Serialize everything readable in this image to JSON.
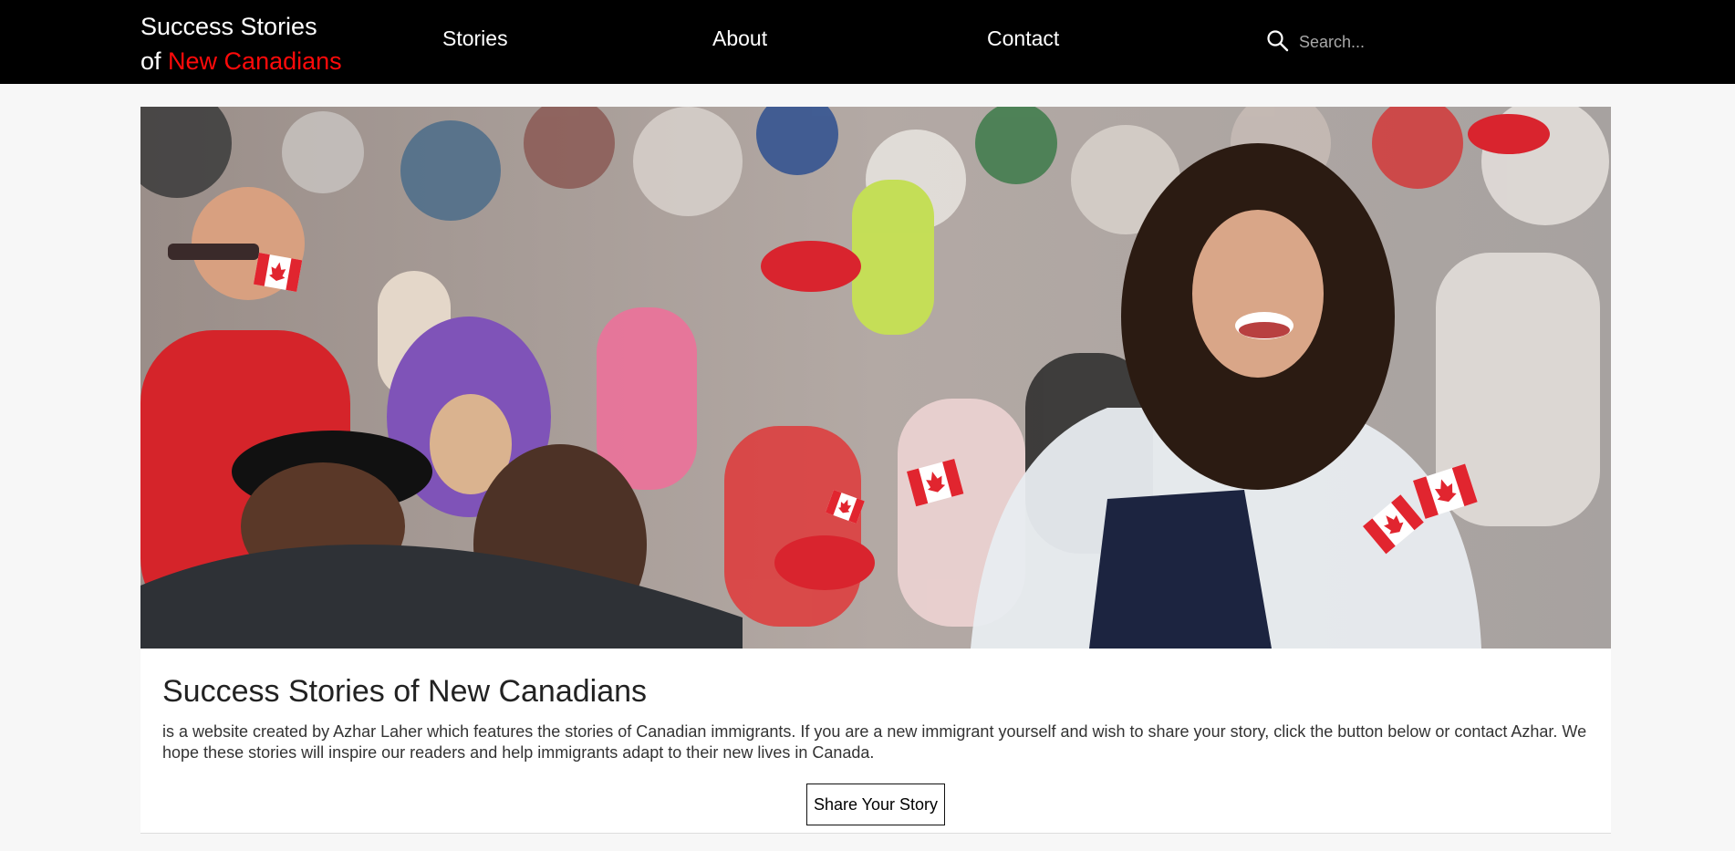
{
  "nav": {
    "brand_line1": "Success Stories",
    "brand_of": "of",
    "brand_highlight": "New Canadians",
    "links": [
      "Stories",
      "About",
      "Contact"
    ],
    "search_placeholder": "Search..."
  },
  "hero": {
    "image_alt": "Crowd at Canada Day celebration"
  },
  "card": {
    "title": "Success Stories of New Canadians",
    "text": "is a website created by Azhar Laher which features the stories of Canadian immigrants. If you are a new immigrant yourself and wish to share your story, click the button below or contact Azhar. We hope these stories will inspire our readers and help immigrants adapt to their new lives in Canada.",
    "button_label": "Share Your Story"
  },
  "colors": {
    "nav_bg": "#000000",
    "brand_accent": "#ff0a0a",
    "page_bg": "#f7f7f7",
    "card_bg": "#ffffff"
  },
  "icons": {
    "search": "search-icon",
    "flag": "maple-leaf-flag"
  }
}
